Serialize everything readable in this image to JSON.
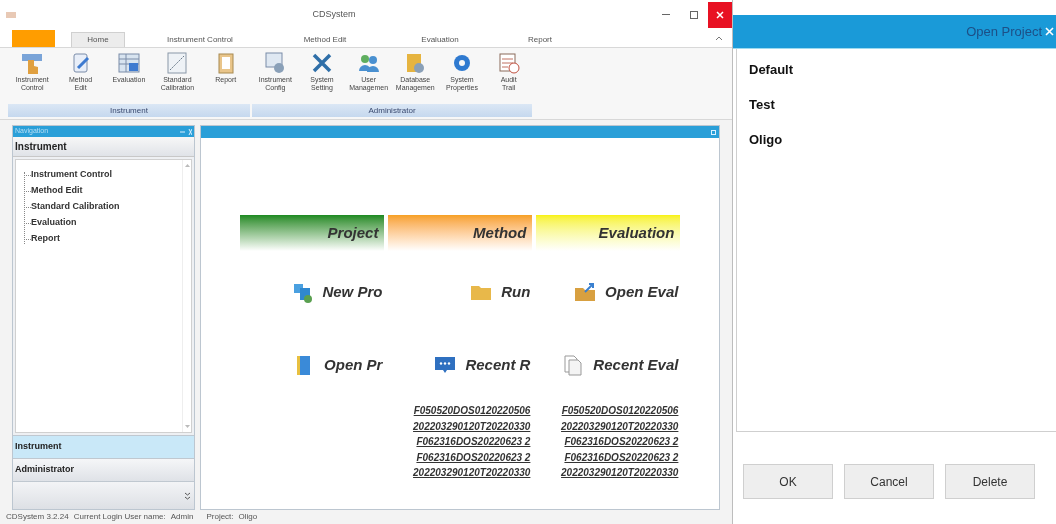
{
  "window": {
    "title": "CDSystem"
  },
  "tabs": [
    {
      "label": "Home",
      "selected": true
    },
    {
      "label": "Instrument Control",
      "selected": false
    },
    {
      "label": "Method Edit",
      "selected": false
    },
    {
      "label": "Evaluation",
      "selected": false
    },
    {
      "label": "Report",
      "selected": false
    }
  ],
  "ribbon": {
    "groups": [
      {
        "label": "Instrument",
        "items": [
          "Instrument\nControl",
          "Method\nEdit",
          "Evaluation",
          "Standard\nCalibration",
          "Report"
        ]
      },
      {
        "label": "Administrator",
        "items": [
          "Instrument\nConfig",
          "System\nSetting",
          "User\nManagemen",
          "Database\nManagemen",
          "System\nProperties",
          "Audit\nTrail"
        ]
      }
    ]
  },
  "navigation": {
    "title": "Navigation",
    "section": "Instrument",
    "tree": [
      "Instrument Control",
      "Method Edit",
      "Standard Calibration",
      "Evaluation",
      "Report"
    ],
    "sections": [
      {
        "label": "Instrument",
        "selected": true
      },
      {
        "label": "Administrator",
        "selected": false
      }
    ]
  },
  "content": {
    "columns": [
      {
        "title": "Project",
        "actions": [
          "New Pro",
          "Open Pr"
        ]
      },
      {
        "title": "Method",
        "actions": [
          "Run",
          "Recent R"
        ],
        "recent": [
          "F050520DOS0120220506",
          "202203290120T20220330",
          "F062316DOS20220623 2",
          "F062316DOS20220623 2",
          "202203290120T20220330"
        ]
      },
      {
        "title": "Evaluation",
        "actions": [
          "Open Eval",
          "Recent Eval"
        ],
        "recent": [
          "F050520DOS0120220506",
          "202203290120T20220330",
          "F062316DOS20220623 2",
          "F062316DOS20220623 2",
          "202203290120T20220330"
        ]
      }
    ]
  },
  "status_bar": {
    "version": "CDSystem 3.2.24",
    "user_label": "Current Login User name:",
    "user": "Admin",
    "project_label": "Project:",
    "project": "Oligo"
  },
  "dialog": {
    "title": "Open Project",
    "projects": [
      "Default",
      "Test",
      "Oligo"
    ],
    "buttons": [
      "OK",
      "Cancel",
      "Delete"
    ]
  }
}
